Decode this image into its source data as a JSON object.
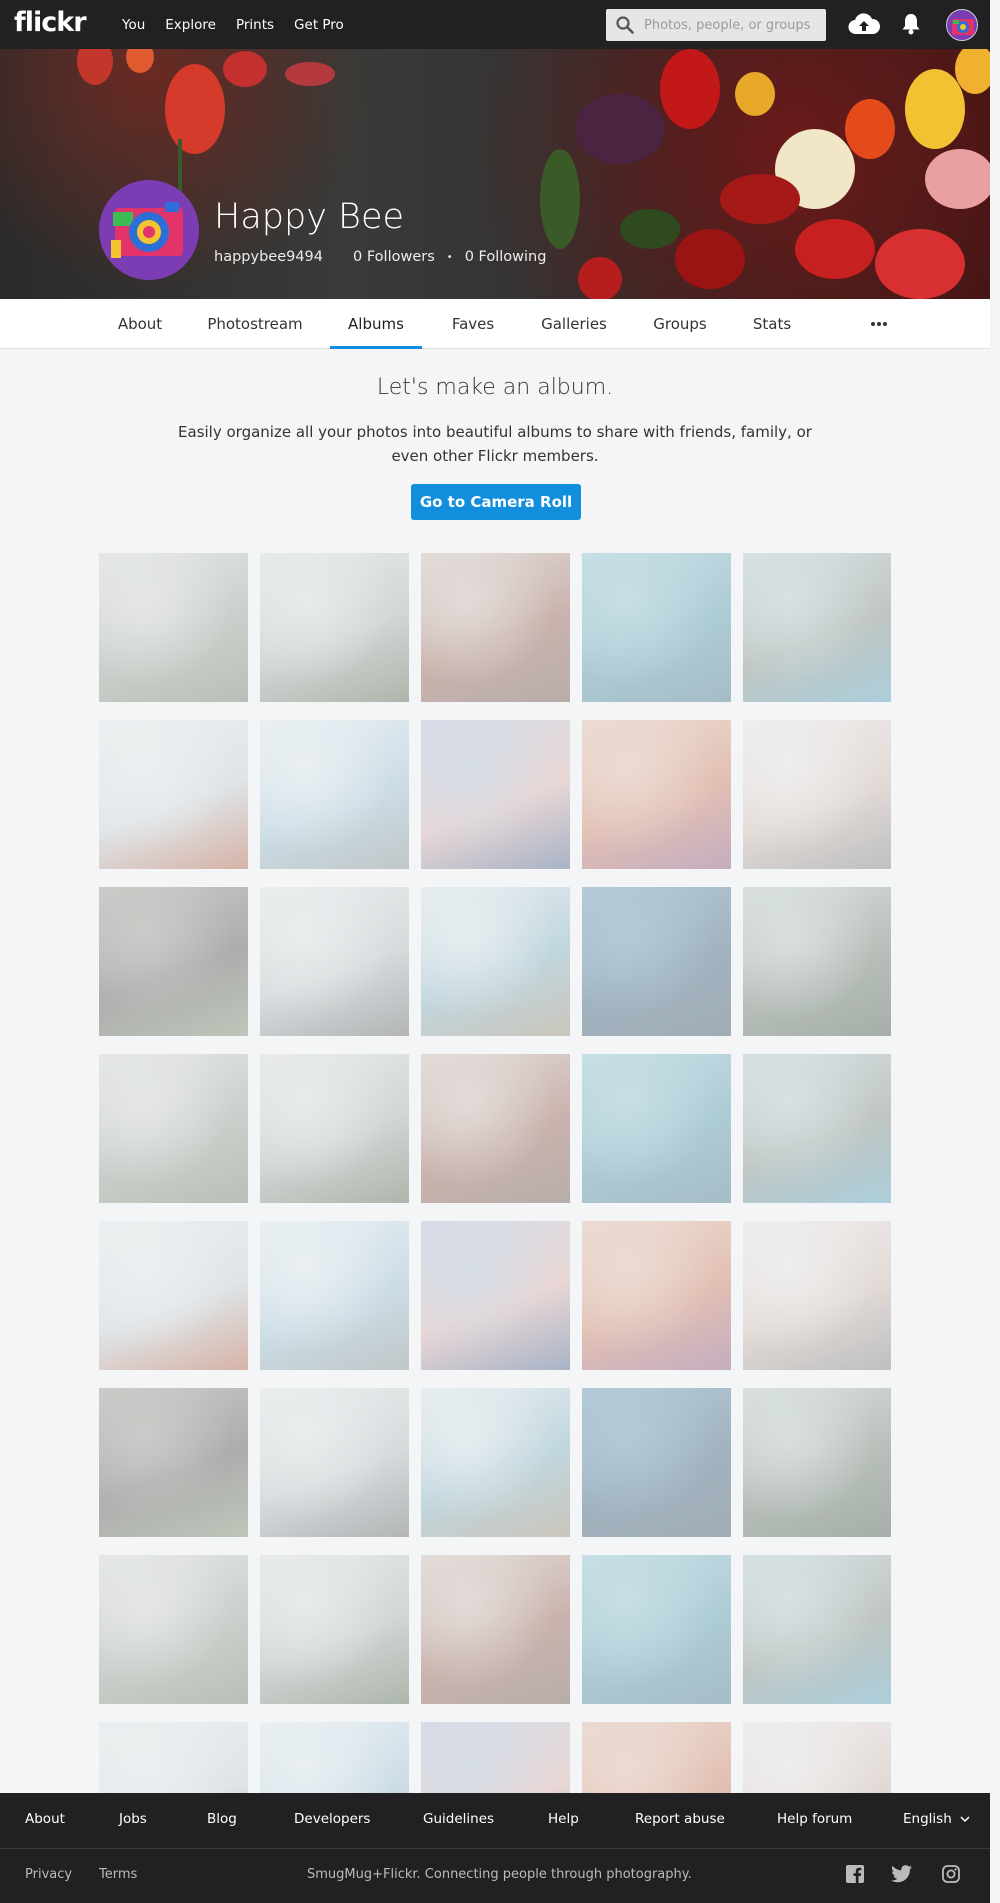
{
  "topnav": {
    "logo": "flickr",
    "links": [
      "You",
      "Explore",
      "Prints",
      "Get Pro"
    ],
    "search_placeholder": "Photos, people, or groups"
  },
  "profile": {
    "name": "Happy Bee",
    "username": "happybee9494",
    "followers": "0 Followers",
    "following": "0 Following"
  },
  "tabs": [
    "About",
    "Photostream",
    "Albums",
    "Faves",
    "Galleries",
    "Groups",
    "Stats"
  ],
  "active_tab": "Albums",
  "empty_state": {
    "heading": "Let's make an album.",
    "description": "Easily organize all your photos into beautiful albums to share with friends, family, or even other Flickr members.",
    "cta": "Go to Camera Roll"
  },
  "footer": {
    "links": [
      "About",
      "Jobs",
      "Blog",
      "Developers",
      "Guidelines",
      "Help",
      "Report abuse",
      "Help forum"
    ],
    "language": "English",
    "bottom_links": [
      "Privacy",
      "Terms"
    ],
    "tagline": "SmugMug+Flickr. Connecting people through photography."
  },
  "colors": {
    "accent": "#128fdc",
    "nav_bg": "#212124",
    "page_bg": "#f3f5f6"
  }
}
